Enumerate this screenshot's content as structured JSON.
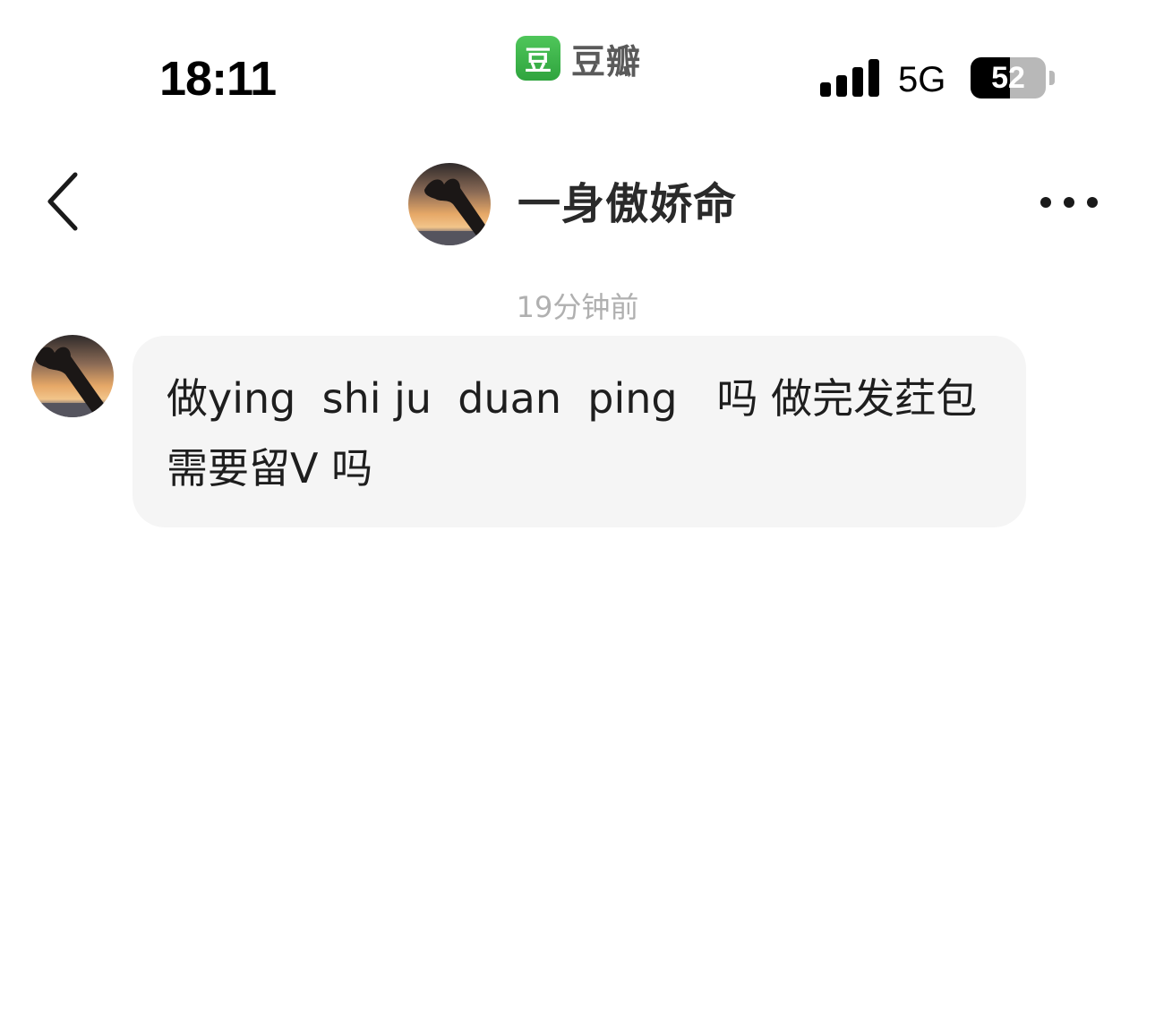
{
  "status_bar": {
    "time": "18:11",
    "app_icon_glyph": "豆",
    "app_name": "豆瓣",
    "network": "5G",
    "battery_percent": "52",
    "battery_level": 0.52,
    "signal_bars": 4
  },
  "header": {
    "contact_name": "一身傲娇命",
    "back_icon": "chevron-left-icon",
    "more_icon": "more-horizontal-icon"
  },
  "chat": {
    "timestamp": "19分钟前",
    "messages": [
      {
        "lines": [
          "做ying  shi ju  duan  ping   吗 做完发荭包",
          "需要留V 吗"
        ]
      }
    ]
  },
  "colors": {
    "app_green": "#3db54a",
    "bubble_bg": "#f5f5f5",
    "timestamp_gray": "#b0b0b0"
  }
}
